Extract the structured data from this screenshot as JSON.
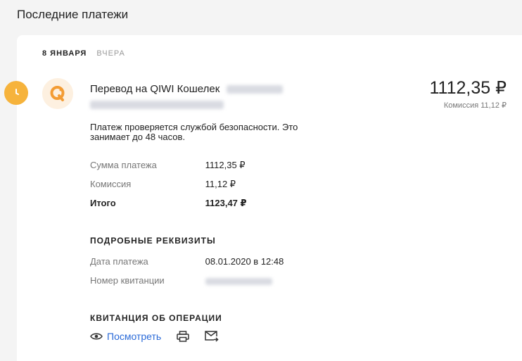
{
  "header": {
    "title": "Последние платежи"
  },
  "date": {
    "main": "8 ЯНВАРЯ",
    "sub": "ВЧЕРА"
  },
  "payment": {
    "title": "Перевод на QIWI Кошелек",
    "amount": "1112,35 ₽",
    "commission_note": "Комиссия 11,12 ₽",
    "status_message": "Платеж проверяется службой безопасности. Это занимает до 48 часов."
  },
  "summary": [
    {
      "label": "Сумма платежа",
      "value": "1112,35 ₽"
    },
    {
      "label": "Комиссия",
      "value": "11,12 ₽"
    },
    {
      "label": "Итого",
      "value": "1123,47 ₽"
    }
  ],
  "details": {
    "title": "ПОДРОБНЫЕ РЕКВИЗИТЫ",
    "rows": [
      {
        "label": "Дата платежа",
        "value": "08.01.2020 в 12:48"
      },
      {
        "label": "Номер квитанции"
      }
    ]
  },
  "receipt": {
    "title": "КВИТАНЦИЯ ОБ ОПЕРАЦИИ",
    "view_label": "Посмотреть"
  },
  "colors": {
    "accent": "#f6b33c",
    "link": "#2a6ad8"
  },
  "icons": {
    "status": "clock-icon",
    "logo": "qiwi-logo-icon",
    "view": "eye-icon",
    "print": "printer-icon",
    "email": "mail-send-icon"
  }
}
